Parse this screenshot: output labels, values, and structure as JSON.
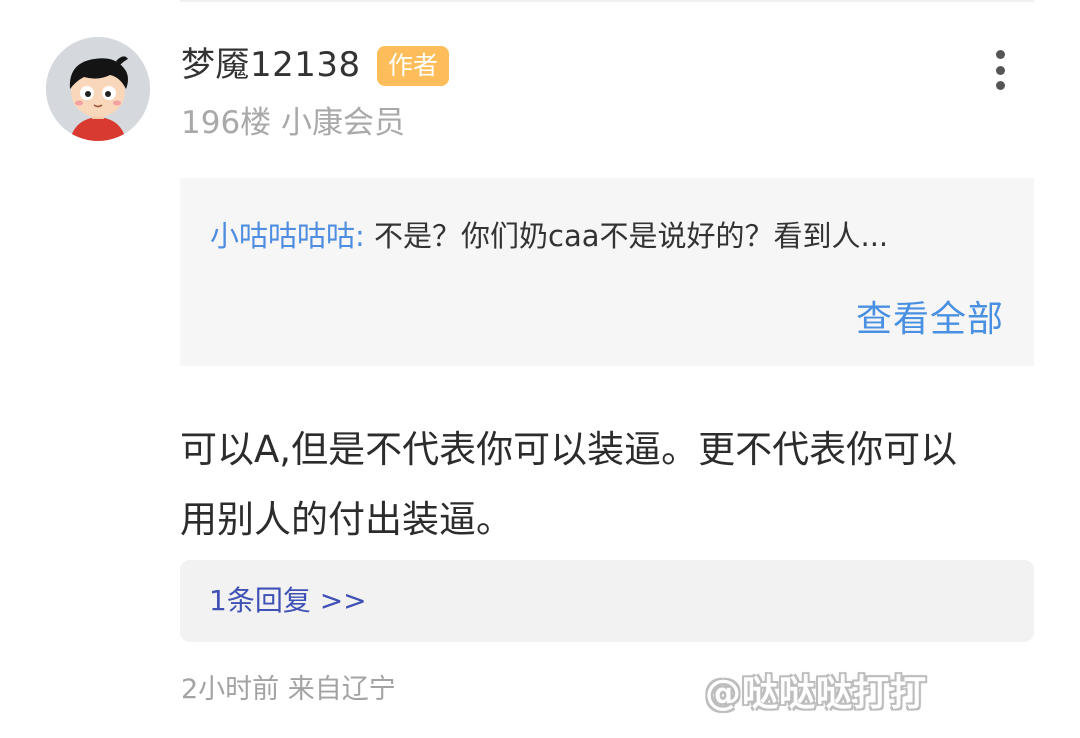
{
  "top_divider": true,
  "comment": {
    "avatar_icon": "cartoon-boy-avatar",
    "username": "梦魇12138",
    "badge": "作者",
    "floor_and_level": "196楼 小康会员",
    "more_icon": "vertical-ellipsis-icon",
    "quote": {
      "user": "小咕咕咕咕:",
      "text": " 不是？你们奶caa不是说好的？看到人...",
      "view_all": "查看全部"
    },
    "body_line1": "可以A,但是不代表你可以装逼。更不代表你可以",
    "body_line2": "用别人的付出装逼。",
    "replies": "1条回复 >>",
    "time_location": "2小时前 来自辽宁"
  },
  "watermark": "@哒哒哒打打",
  "colors": {
    "badge_bg": "#fdbd5a",
    "link_blue": "#4a90e2",
    "reply_link": "#3f51b5",
    "muted": "#a9a9a9"
  }
}
